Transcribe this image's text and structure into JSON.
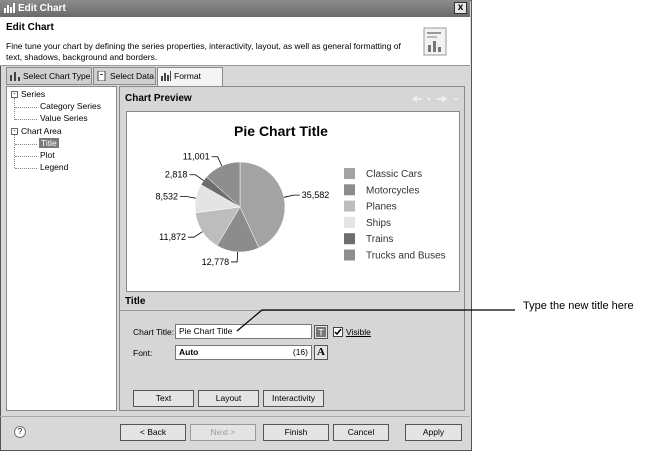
{
  "window": {
    "title": "Edit Chart",
    "close_label": "x"
  },
  "header": {
    "title": "Edit Chart",
    "description": "Fine tune your chart by defining the series properties, interactivity, layout, as well as general formatting of text, shadows, background and borders."
  },
  "tabs": [
    {
      "label": "Select Chart Type",
      "active": false
    },
    {
      "label": "Select Data",
      "active": false
    },
    {
      "label": "Format Chart",
      "active": true
    }
  ],
  "tree": {
    "series": "Series",
    "category_series": "Category Series",
    "value_series": "Value Series",
    "chart_area": "Chart Area",
    "title": "Title",
    "plot": "Plot",
    "legend": "Legend",
    "expander": "-"
  },
  "preview": {
    "heading": "Chart Preview"
  },
  "chart_data": {
    "type": "pie",
    "title": "Pie Chart Title",
    "categories": [
      "Classic Cars",
      "Motorcycles",
      "Planes",
      "Ships",
      "Trains",
      "Trucks and Buses"
    ],
    "values": [
      35582,
      12778,
      11872,
      8532,
      2818,
      11001
    ],
    "labels": [
      "35,582",
      "12,778",
      "11,872",
      "8,532",
      "2,818",
      "11,001"
    ],
    "colors": [
      "#a3a3a3",
      "#8c8c8c",
      "#bdbdbd",
      "#e4e4e4",
      "#6e6e6e",
      "#8e8e8e"
    ],
    "legend_position": "right"
  },
  "title_section": {
    "heading": "Title",
    "chart_title_label": "Chart Title:",
    "chart_title_value": "Pie Chart Title",
    "visible_label": "Visible",
    "visible_checked": true,
    "font_label": "Font:",
    "font_value": "Auto",
    "font_size": "(16)",
    "font_button": "A"
  },
  "buttons": {
    "text": "Text",
    "layout": "Layout",
    "interactivity": "Interactivity"
  },
  "footer": {
    "back": "< Back",
    "next": "Next >",
    "finish": "Finish",
    "cancel": "Cancel",
    "apply": "Apply",
    "help": "?"
  },
  "callout": {
    "text": "Type the new title here"
  }
}
